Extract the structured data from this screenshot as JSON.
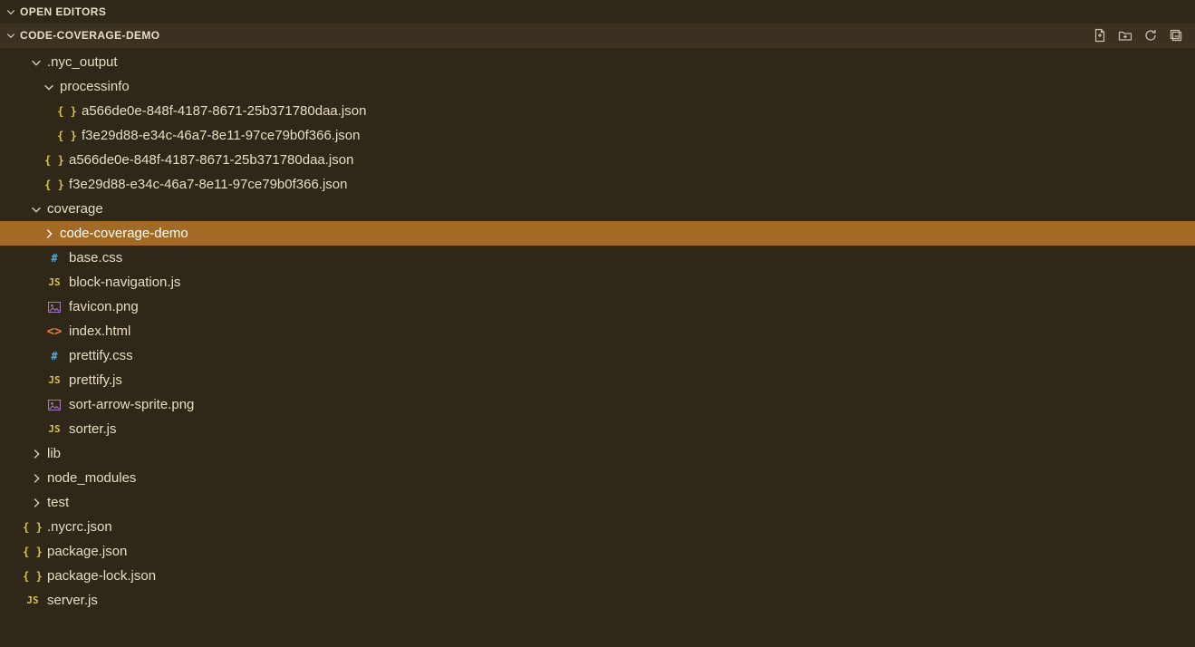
{
  "sections": {
    "open_editors": "OPEN EDITORS",
    "project_name": "CODE-COVERAGE-DEMO"
  },
  "tree": [
    {
      "depth": 0,
      "kind": "folder",
      "state": "open",
      "label": ".nyc_output"
    },
    {
      "depth": 1,
      "kind": "folder",
      "state": "open",
      "label": "processinfo"
    },
    {
      "depth": 2,
      "kind": "file",
      "icon": "json",
      "label": "a566de0e-848f-4187-8671-25b371780daa.json"
    },
    {
      "depth": 2,
      "kind": "file",
      "icon": "json",
      "label": "f3e29d88-e34c-46a7-8e11-97ce79b0f366.json"
    },
    {
      "depth": 1,
      "kind": "file",
      "icon": "json",
      "label": "a566de0e-848f-4187-8671-25b371780daa.json"
    },
    {
      "depth": 1,
      "kind": "file",
      "icon": "json",
      "label": "f3e29d88-e34c-46a7-8e11-97ce79b0f366.json"
    },
    {
      "depth": 0,
      "kind": "folder",
      "state": "open",
      "label": "coverage"
    },
    {
      "depth": 1,
      "kind": "folder",
      "state": "closed",
      "label": "code-coverage-demo",
      "selected": true
    },
    {
      "depth": 1,
      "kind": "file",
      "icon": "css",
      "label": "base.css"
    },
    {
      "depth": 1,
      "kind": "file",
      "icon": "js",
      "label": "block-navigation.js"
    },
    {
      "depth": 1,
      "kind": "file",
      "icon": "img",
      "label": "favicon.png"
    },
    {
      "depth": 1,
      "kind": "file",
      "icon": "html",
      "label": "index.html"
    },
    {
      "depth": 1,
      "kind": "file",
      "icon": "css",
      "label": "prettify.css"
    },
    {
      "depth": 1,
      "kind": "file",
      "icon": "js",
      "label": "prettify.js"
    },
    {
      "depth": 1,
      "kind": "file",
      "icon": "img",
      "label": "sort-arrow-sprite.png"
    },
    {
      "depth": 1,
      "kind": "file",
      "icon": "js",
      "label": "sorter.js"
    },
    {
      "depth": 0,
      "kind": "folder",
      "state": "closed",
      "label": "lib"
    },
    {
      "depth": 0,
      "kind": "folder",
      "state": "closed",
      "label": "node_modules"
    },
    {
      "depth": 0,
      "kind": "folder",
      "state": "closed",
      "label": "test"
    },
    {
      "depth": 0,
      "kind": "file",
      "icon": "json",
      "label": ".nycrc.json",
      "offset": -1
    },
    {
      "depth": 0,
      "kind": "file",
      "icon": "json",
      "label": "package.json",
      "offset": -1
    },
    {
      "depth": 0,
      "kind": "file",
      "icon": "json",
      "label": "package-lock.json",
      "offset": -1
    },
    {
      "depth": 0,
      "kind": "file",
      "icon": "js",
      "label": "server.js",
      "offset": -1
    }
  ]
}
